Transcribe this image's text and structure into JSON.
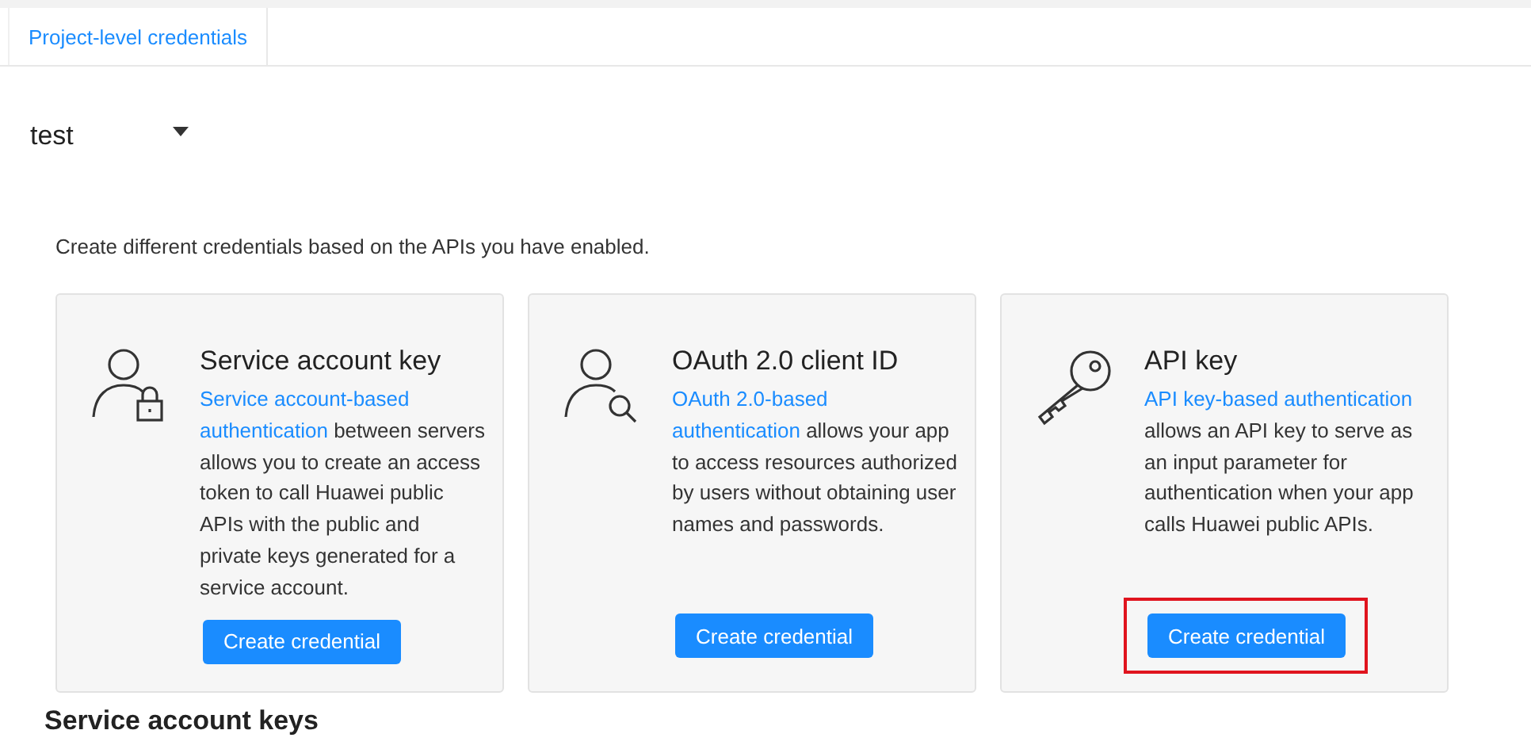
{
  "tabs": [
    {
      "label": "Project-level credentials",
      "selected": true
    }
  ],
  "project_select": {
    "value": "test"
  },
  "description": "Create different credentials based on the APIs you have enabled.",
  "cards": [
    {
      "kind": "service-account",
      "title": "Service account key",
      "link": [
        "Service account-based",
        "authentication"
      ],
      "text": " between servers allows you to create an access token to call Huawei public APIs with the public and private keys generated for a service account.",
      "button": "Create credential",
      "highlighted": false
    },
    {
      "kind": "oauth",
      "title": "OAuth 2.0 client ID",
      "link": [
        "OAuth 2.0-based",
        "authentication"
      ],
      "text": " allows your app to access resources authorized by users without obtaining user names and passwords.",
      "button": "Create credential",
      "highlighted": false
    },
    {
      "kind": "api-key",
      "title": "API key",
      "link": [
        "API key-based authentication"
      ],
      "text": " allows an API key to serve as an input parameter for authentication when your app calls Huawei public APIs.",
      "button": "Create credential",
      "highlighted": true
    }
  ],
  "section_heading": "Service account keys"
}
